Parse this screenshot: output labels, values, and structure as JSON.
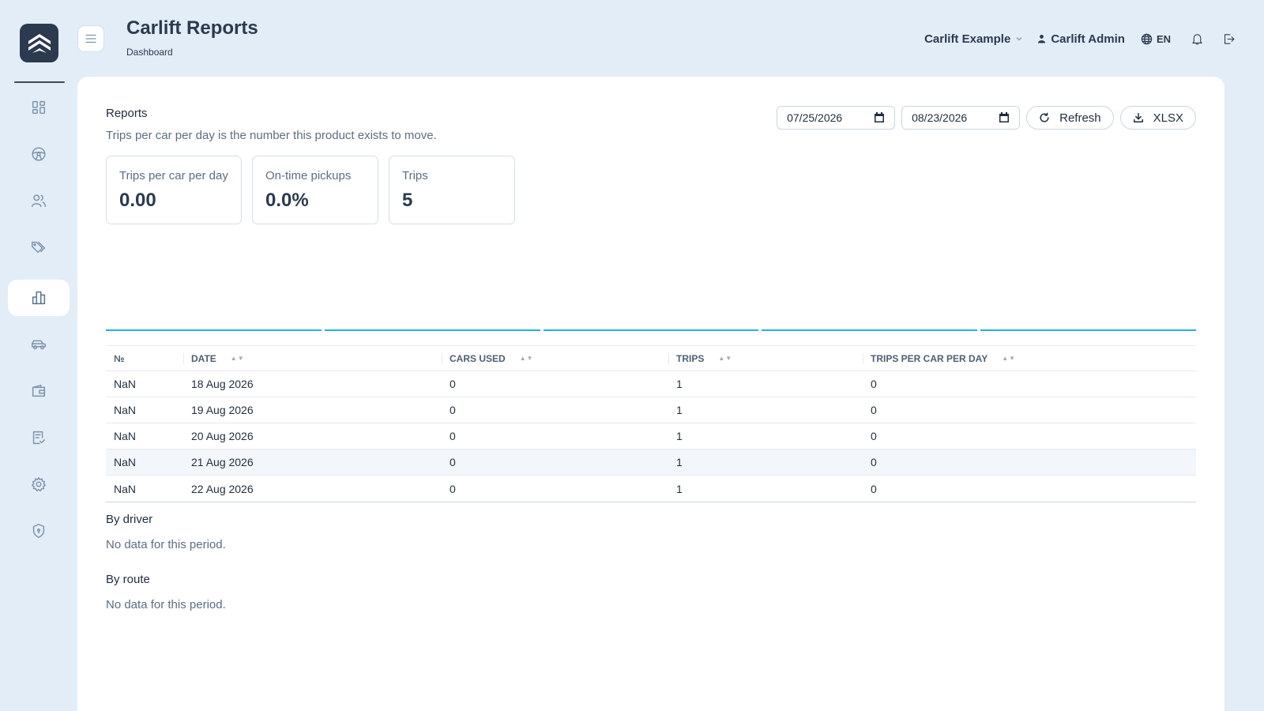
{
  "app": {
    "title": "Carlift Reports",
    "breadcrumb": "Dashboard",
    "logo_icon": "carlift-chevrons-logo"
  },
  "sidebar": {
    "items": [
      {
        "name": "dashboard",
        "icon": "grid-icon",
        "active": false
      },
      {
        "name": "drivers",
        "icon": "steering-wheel-icon",
        "active": false
      },
      {
        "name": "users",
        "icon": "users-icon",
        "active": false
      },
      {
        "name": "pricing",
        "icon": "tags-icon",
        "active": false
      },
      {
        "name": "reports",
        "icon": "bar-chart-icon",
        "active": true
      },
      {
        "name": "cars",
        "icon": "car-icon",
        "active": false
      },
      {
        "name": "wallet",
        "icon": "wallet-icon",
        "active": false
      },
      {
        "name": "tasks",
        "icon": "checklist-icon",
        "active": false
      },
      {
        "name": "settings",
        "icon": "gear-icon",
        "active": false
      },
      {
        "name": "security",
        "icon": "shield-icon",
        "active": false
      }
    ]
  },
  "header": {
    "org": "Carlift Example",
    "user": "Carlift Admin",
    "lang": "EN"
  },
  "reports": {
    "title": "Reports",
    "subtitle": "Trips per car per day is the number this product exists to move.",
    "date_from": "07/25/2026",
    "date_to": "08/23/2026",
    "refresh_label": "Refresh",
    "export_label": "XLSX"
  },
  "kpis": [
    {
      "label": "Trips per car per day",
      "value": "0.00"
    },
    {
      "label": "On-time pickups",
      "value": "0.0%"
    },
    {
      "label": "Trips",
      "value": "5"
    }
  ],
  "table": {
    "columns": [
      "№",
      "DATE",
      "CARS USED",
      "TRIPS",
      "TRIPS PER CAR PER DAY"
    ],
    "sort_glyph": "▲▼",
    "rows": [
      [
        "NaN",
        "18 Aug 2026",
        "0",
        "1",
        "0"
      ],
      [
        "NaN",
        "19 Aug 2026",
        "0",
        "1",
        "0"
      ],
      [
        "NaN",
        "20 Aug 2026",
        "0",
        "1",
        "0"
      ],
      [
        "NaN",
        "21 Aug 2026",
        "0",
        "1",
        "0"
      ],
      [
        "NaN",
        "22 Aug 2026",
        "0",
        "1",
        "0"
      ]
    ]
  },
  "by_driver": {
    "title": "By driver",
    "empty": "No data for this period."
  },
  "by_route": {
    "title": "By route",
    "empty": "No data for this period."
  },
  "colors": {
    "accent": "#1fb2df",
    "background": "#e3edf7",
    "text": "#2b3a4e"
  }
}
